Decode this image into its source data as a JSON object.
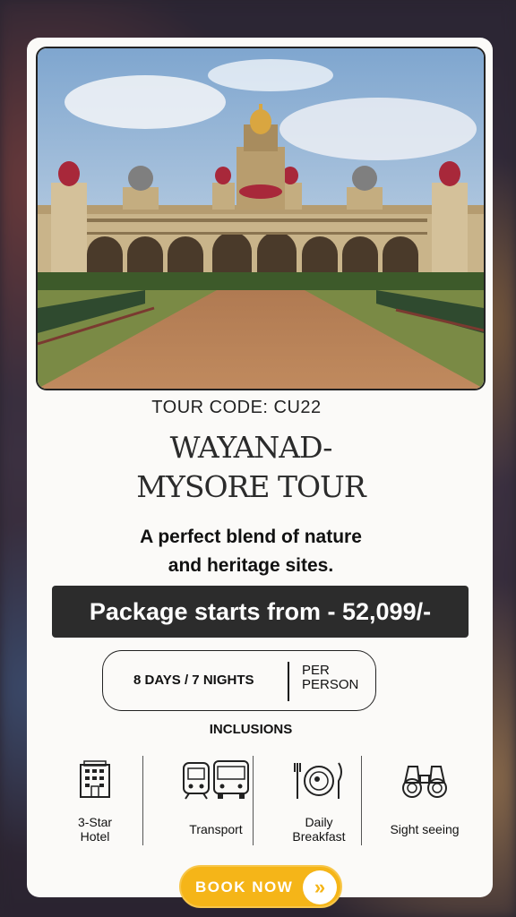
{
  "tour_code": "TOUR CODE: CU22",
  "title_line1": "WAYANAD-",
  "title_line2": "MYSORE TOUR",
  "tagline_line1": "A perfect blend of nature",
  "tagline_line2": "and heritage sites.",
  "price_text": "Package starts from - 52,099/-",
  "duration": "8 DAYS / 7 NIGHTS",
  "per_person_line1": "PER",
  "per_person_line2": "PERSON",
  "inclusions_title": "INCLUSIONS",
  "inclusions": [
    {
      "icon": "hotel-icon",
      "line1": "3-Star",
      "line2": "Hotel"
    },
    {
      "icon": "transport-icon",
      "line1": "Transport",
      "line2": ""
    },
    {
      "icon": "breakfast-icon",
      "line1": "Daily",
      "line2": "Breakfast"
    },
    {
      "icon": "binoculars-icon",
      "line1": "Sight seeing",
      "line2": ""
    }
  ],
  "book_button": "BOOK NOW",
  "book_arrow": "»",
  "colors": {
    "banner": "#2c2c2c",
    "button": "#f5b518",
    "card": "#fbfaf8"
  }
}
